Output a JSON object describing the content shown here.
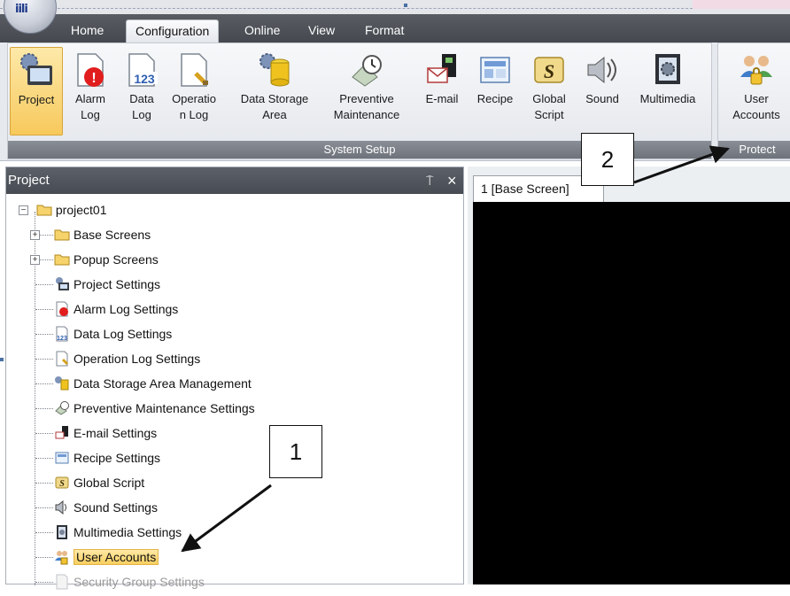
{
  "ribbon": {
    "tabs": [
      {
        "label": "Home",
        "active": false
      },
      {
        "label": "Configuration",
        "active": true
      },
      {
        "label": "Online",
        "active": false
      },
      {
        "label": "View",
        "active": false
      },
      {
        "label": "Format",
        "active": false
      }
    ],
    "system_setup": {
      "group_label": "System Setup",
      "buttons": [
        {
          "line1": "Project",
          "line2": "",
          "icon": "project-icon",
          "active": true
        },
        {
          "line1": "Alarm",
          "line2": "Log",
          "icon": "alarm-log-icon"
        },
        {
          "line1": "Data",
          "line2": "Log",
          "icon": "data-log-icon"
        },
        {
          "line1": "Operatio",
          "line2": "n Log",
          "icon": "operation-log-icon"
        },
        {
          "line1": "Data Storage",
          "line2": "Area",
          "icon": "data-storage-icon"
        },
        {
          "line1": "Preventive",
          "line2": "Maintenance",
          "icon": "preventive-maintenance-icon"
        },
        {
          "line1": "E-mail",
          "line2": "",
          "icon": "email-icon"
        },
        {
          "line1": "Recipe",
          "line2": "",
          "icon": "recipe-icon"
        },
        {
          "line1": "Global",
          "line2": "Script",
          "icon": "global-script-icon"
        },
        {
          "line1": "Sound",
          "line2": "",
          "icon": "sound-icon"
        },
        {
          "line1": "Multimedia",
          "line2": "",
          "icon": "multimedia-icon"
        }
      ]
    },
    "protect": {
      "group_label": "Protect",
      "buttons": [
        {
          "line1": "User",
          "line2": "Accounts",
          "icon": "user-accounts-icon"
        }
      ]
    }
  },
  "project_panel": {
    "title": "Project",
    "pin_glyph": "⍑",
    "close_glyph": "×",
    "tree": {
      "root": "project01",
      "items": [
        {
          "label": "Base Screens",
          "icon": "folder-icon",
          "expandable": true
        },
        {
          "label": "Popup Screens",
          "icon": "folder-icon",
          "expandable": true
        },
        {
          "label": "Project Settings",
          "icon": "project-icon"
        },
        {
          "label": "Alarm Log Settings",
          "icon": "alarm-log-icon"
        },
        {
          "label": "Data Log Settings",
          "icon": "data-log-icon"
        },
        {
          "label": "Operation Log Settings",
          "icon": "operation-log-icon"
        },
        {
          "label": "Data Storage Area Management",
          "icon": "data-storage-icon"
        },
        {
          "label": "Preventive Maintenance Settings",
          "icon": "preventive-maintenance-icon"
        },
        {
          "label": "E-mail Settings",
          "icon": "email-icon"
        },
        {
          "label": "Recipe Settings",
          "icon": "recipe-icon"
        },
        {
          "label": "Global Script",
          "icon": "global-script-icon"
        },
        {
          "label": "Sound Settings",
          "icon": "sound-icon"
        },
        {
          "label": "Multimedia Settings",
          "icon": "multimedia-icon"
        },
        {
          "label": "User Accounts",
          "icon": "user-accounts-icon",
          "selected": true
        },
        {
          "label": "Security Group Settings",
          "icon": "security-group-icon",
          "faded": true
        }
      ]
    }
  },
  "editor": {
    "tab_label": "1  [Base Screen]",
    "canvas_color": "#000000"
  },
  "callouts": {
    "one": "1",
    "two": "2"
  },
  "colors": {
    "tab_bar": "#505459",
    "group_label_bar": "#7c8189",
    "selection_yellow": "#f8cf5f",
    "canvas": "#000000"
  }
}
